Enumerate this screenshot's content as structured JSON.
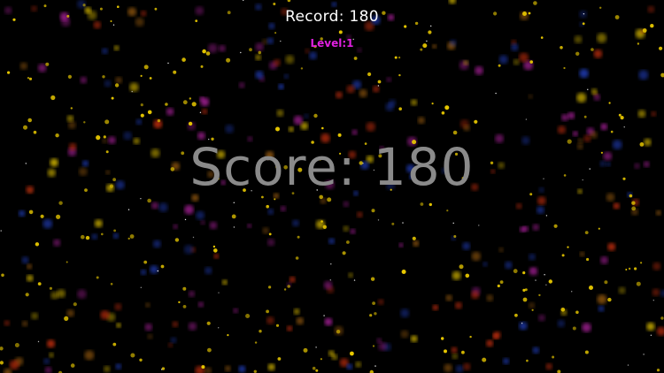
{
  "hud": {
    "record_label": "Record:",
    "record_value": "180",
    "level_label": "Level:",
    "level_value": "1"
  },
  "score": {
    "label": "Score:",
    "value": "180"
  },
  "colors": {
    "background": "#000000",
    "record_text": "#ffffff",
    "level_text": "#e020e0",
    "score_text": "#8a8a8a",
    "particle_palette": [
      "#e8c800",
      "#d03010",
      "#b020a0",
      "#2040c0",
      "#a06010",
      "#ffffff"
    ]
  }
}
